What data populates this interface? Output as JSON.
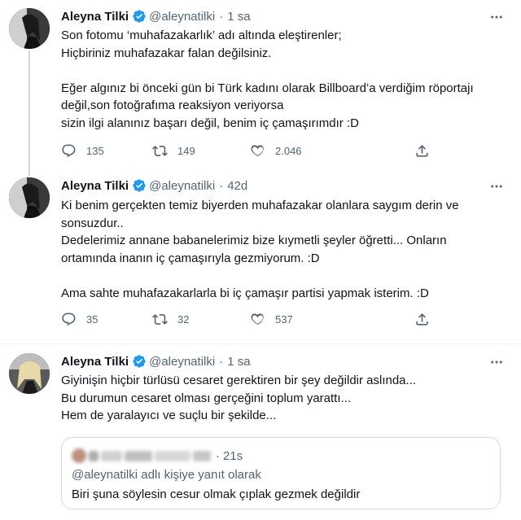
{
  "colors": {
    "accent": "#1d9bf0",
    "secondary_text": "#536471",
    "primary_text": "#0f1419",
    "border": "#cfd9de"
  },
  "tweets": [
    {
      "author": "Aleyna Tilki",
      "handle": "@aleynatilki",
      "separator": "·",
      "time": "1 sa",
      "verified_icon": "verified-badge-icon",
      "lines": [
        "Son fotomu ‘muhafazakarlık’ adı altında eleştirenler;",
        "Hiçbiriniz muhafazakar falan değilsiniz.",
        "",
        "Eğer algınız bi önceki gün bi Türk kadını olarak Billboard’a verdiğim röportajı",
        "değil,son fotoğrafıma reaksiyon veriyorsa",
        "sizin ilgi alanınız başarı değil, benim iç çamaşırımdır :D"
      ],
      "replies": "135",
      "retweets": "149",
      "likes": "2.046"
    },
    {
      "author": "Aleyna Tilki",
      "handle": "@aleynatilki",
      "separator": "·",
      "time": "42d",
      "verified_icon": "verified-badge-icon",
      "lines": [
        "Ki benim gerçekten temiz biyerden muhafazakar olanlara saygım derin ve",
        "sonsuzdur..",
        "Dedelerimiz annane babanelerimiz bize kıymetli şeyler öğretti... Onların",
        "ortamında inanın iç çamaşırıyla gezmiyorum. :D",
        "",
        "Ama sahte muhafazakarlarla bi iç çamaşır partisi yapmak isterim. :D"
      ],
      "replies": "35",
      "retweets": "32",
      "likes": "537"
    },
    {
      "author": "Aleyna Tilki",
      "handle": "@aleynatilki",
      "separator": "·",
      "time": "1 sa",
      "verified_icon": "verified-badge-icon",
      "lines": [
        "Giyinişin hiçbir türlüsü cesaret gerektiren bir şey değildir aslında...",
        "Bu durumun cesaret olması gerçeğini toplum yarattı...",
        "Hem de yaralayıcı ve suçlu bir şekilde..."
      ],
      "quote": {
        "separator": "·",
        "time": "21s",
        "reply_to": "@aleynatilki adlı kişiye yanıt olarak",
        "text": "Biri şuna söylesin cesur olmak çıplak gezmek değildir"
      }
    }
  ]
}
